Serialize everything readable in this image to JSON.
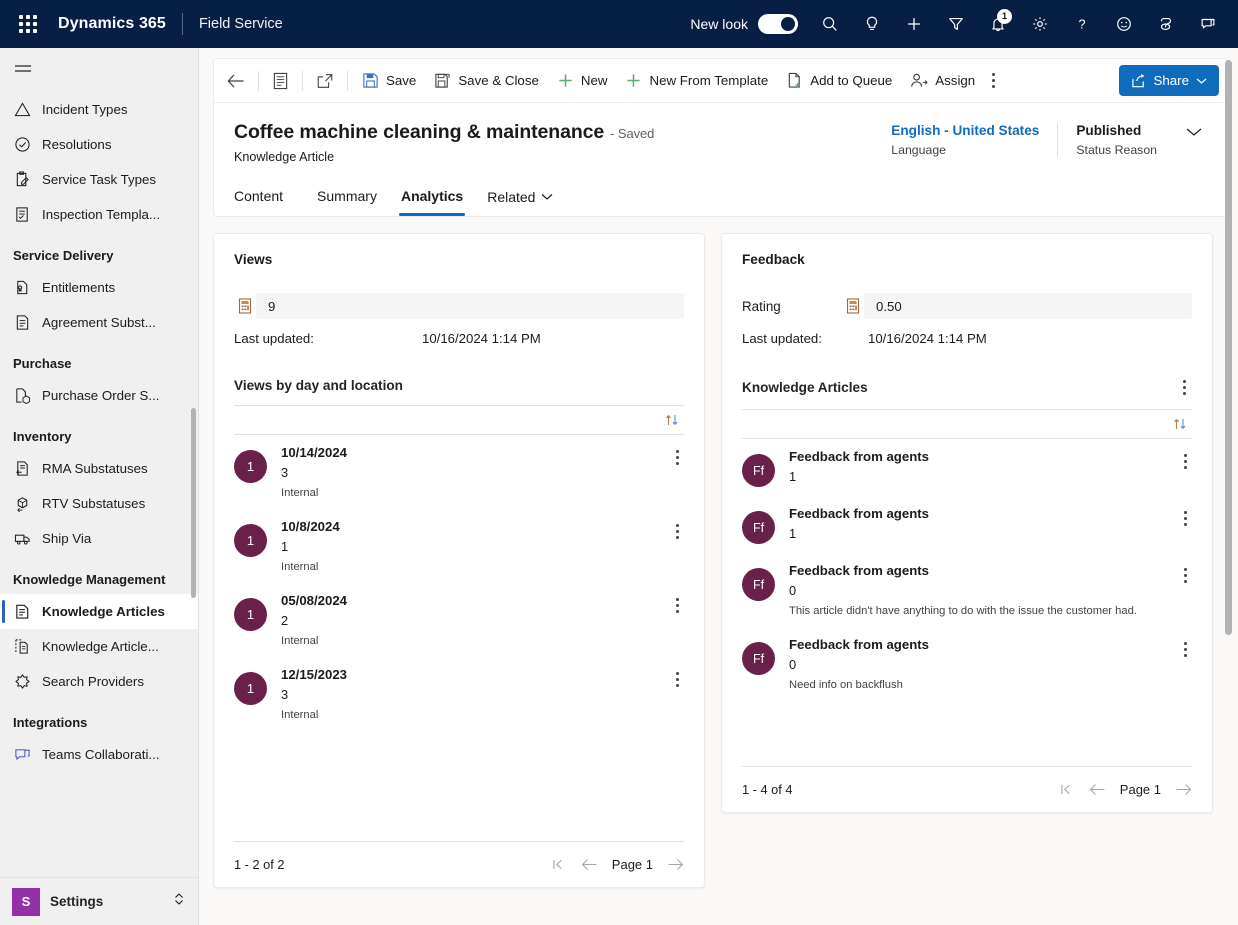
{
  "topbar": {
    "waffle_label": "app-launcher",
    "brand": "Dynamics 365",
    "app_name": "Field Service",
    "new_look_label": "New look",
    "new_look_on": true,
    "notification_count": "1",
    "icons": [
      "search-icon",
      "lightbulb-icon",
      "plus-icon",
      "filter-icon",
      "bell-icon",
      "gear-icon",
      "question-icon",
      "smiley-icon",
      "copilot-icon",
      "teams-chat-icon"
    ],
    "background": "#071f45"
  },
  "sidebar": {
    "hamburger": "menu-icon",
    "items": [
      {
        "label": "Incident Types",
        "icon": "warning-triangle-icon",
        "type": "item",
        "active": false
      },
      {
        "label": "Resolutions",
        "icon": "check-circle-icon",
        "type": "item",
        "active": false
      },
      {
        "label": "Service Task Types",
        "icon": "clipboard-pen-icon",
        "type": "item",
        "active": false
      },
      {
        "label": "Inspection Templa...",
        "icon": "checklist-icon",
        "type": "item",
        "active": false
      },
      {
        "label": "Service Delivery",
        "type": "group"
      },
      {
        "label": "Entitlements",
        "icon": "entitlement-doc-icon",
        "type": "item",
        "active": false
      },
      {
        "label": "Agreement Subst...",
        "icon": "document-lines-icon",
        "type": "item",
        "active": false
      },
      {
        "label": "Purchase",
        "type": "group"
      },
      {
        "label": "Purchase Order S...",
        "icon": "purchase-box-icon",
        "type": "item",
        "active": false
      },
      {
        "label": "Inventory",
        "type": "group"
      },
      {
        "label": "RMA Substatuses",
        "icon": "doc-return-icon",
        "type": "item",
        "active": false
      },
      {
        "label": "RTV Substatuses",
        "icon": "box-return-icon",
        "type": "item",
        "active": false
      },
      {
        "label": "Ship Via",
        "icon": "truck-icon",
        "type": "item",
        "active": false
      },
      {
        "label": "Knowledge Management",
        "type": "group"
      },
      {
        "label": "Knowledge Articles",
        "icon": "knowledge-article-icon",
        "type": "item",
        "active": true
      },
      {
        "label": "Knowledge Article...",
        "icon": "knowledge-template-icon",
        "type": "item",
        "active": false
      },
      {
        "label": "Search Providers",
        "icon": "search-provider-icon",
        "type": "item",
        "active": false
      },
      {
        "label": "Integrations",
        "type": "group"
      },
      {
        "label": "Teams Collaborati...",
        "icon": "teams-icon",
        "type": "item",
        "active": false
      }
    ],
    "settings": {
      "initial": "S",
      "label": "Settings",
      "chevron": "chevron-updown-icon"
    },
    "active_accent": "#2a62c6"
  },
  "commandbar": {
    "back": "back-arrow-icon",
    "form_selector": "form-list-icon",
    "popout": "open-new-window-icon",
    "buttons": [
      {
        "label": "Save",
        "icon": "save-icon"
      },
      {
        "label": "Save & Close",
        "icon": "save-close-icon"
      },
      {
        "label": "New",
        "icon": "plus-icon"
      },
      {
        "label": "New From Template",
        "icon": "plus-icon"
      },
      {
        "label": "Add to Queue",
        "icon": "add-queue-icon"
      },
      {
        "label": "Assign",
        "icon": "assign-person-icon"
      }
    ],
    "overflow": "more-commands-icon",
    "share": {
      "label": "Share",
      "icon": "share-icon",
      "chevron": "chevron-down-icon",
      "color": "#0f6cbd"
    }
  },
  "record": {
    "title": "Coffee machine cleaning & maintenance",
    "saved_state": "- Saved",
    "entity": "Knowledge Article",
    "language_value": "English - United States",
    "language_label": "Language",
    "status_value": "Published",
    "status_label": "Status Reason",
    "expand_icon": "chevron-down-icon",
    "tabs": [
      {
        "label": "Content",
        "active": false
      },
      {
        "label": "Summary",
        "active": false
      },
      {
        "label": "Analytics",
        "active": true
      },
      {
        "label": "Related",
        "active": false,
        "has_chevron": true
      }
    ]
  },
  "views_panel": {
    "title": "Views",
    "metric_icon": "calculator-icon",
    "metric_value": "9",
    "last_updated_label": "Last updated:",
    "last_updated_value": "10/16/2024 1:14 PM",
    "subgrid_title": "Views by day and location",
    "sort_icon": "sort-arrows-icon",
    "rows": [
      {
        "avatar": "1",
        "date": "10/14/2024",
        "count": "3",
        "source": "Internal"
      },
      {
        "avatar": "1",
        "date": "10/8/2024",
        "count": "1",
        "source": "Internal"
      },
      {
        "avatar": "1",
        "date": "05/08/2024",
        "count": "2",
        "source": "Internal"
      },
      {
        "avatar": "1",
        "date": "12/15/2023",
        "count": "3",
        "source": "Internal"
      }
    ],
    "pager": {
      "range": "1 - 2 of 2",
      "page_label": "Page 1"
    }
  },
  "feedback_panel": {
    "title": "Feedback",
    "rating_label": "Rating",
    "metric_icon": "calculator-icon",
    "rating_value": "0.50",
    "last_updated_label": "Last updated:",
    "last_updated_value": "10/16/2024 1:14 PM",
    "subgrid_title": "Knowledge Articles",
    "subgrid_kebab": "more-options-icon",
    "sort_icon": "sort-arrows-icon",
    "rows": [
      {
        "avatar": "Ff",
        "title": "Feedback from agents",
        "score": "1",
        "comment": ""
      },
      {
        "avatar": "Ff",
        "title": "Feedback from agents",
        "score": "1",
        "comment": ""
      },
      {
        "avatar": "Ff",
        "title": "Feedback from agents",
        "score": "0",
        "comment": "This article didn't have anything to do with the issue the customer had."
      },
      {
        "avatar": "Ff",
        "title": "Feedback from agents",
        "score": "0",
        "comment": "Need info on backflush"
      }
    ],
    "pager": {
      "range": "1 - 4 of 4",
      "page_label": "Page 1"
    }
  },
  "pager_icons": {
    "first": "first-page-icon",
    "prev": "previous-page-icon",
    "next": "next-page-icon"
  },
  "colors": {
    "avatar": "#69214a",
    "accent": "#0f6cbd",
    "topbar": "#071f45"
  }
}
